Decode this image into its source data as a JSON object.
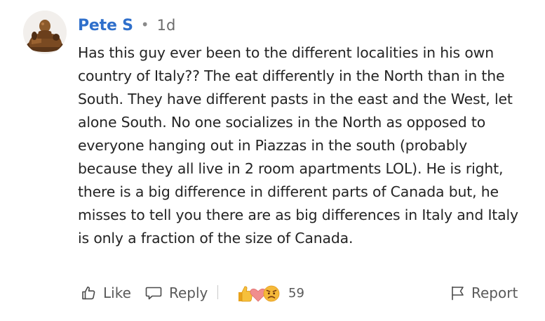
{
  "comment": {
    "author": "Pete S",
    "separator": "•",
    "time_ago": "1d",
    "text": "Has this guy ever been to the different localities in his own country of Italy?? The eat differently in the North than in the South. They have different pasts in the east and the West, let alone South. No one socializes in the North as opposed to everyone hanging out in Piazzas in the south (probably because they all live in 2 room apartments LOL). He is right, there is a big difference in different parts of Canada but, he misses to tell you there are as big differences in Italy and Italy is only a fraction of the size of Canada."
  },
  "actions": {
    "like_label": "Like",
    "reply_label": "Reply",
    "reaction_count": "59",
    "report_label": "Report"
  },
  "icons": {
    "like": "thumbs-up-outline-icon",
    "reply": "speech-bubble-icon",
    "reactions": [
      "thumbs-up-reaction",
      "heart-reaction",
      "frown-reaction"
    ],
    "report": "flag-icon"
  },
  "colors": {
    "author": "#2f6fcb",
    "text": "#242424",
    "muted": "#5a5a5a"
  }
}
